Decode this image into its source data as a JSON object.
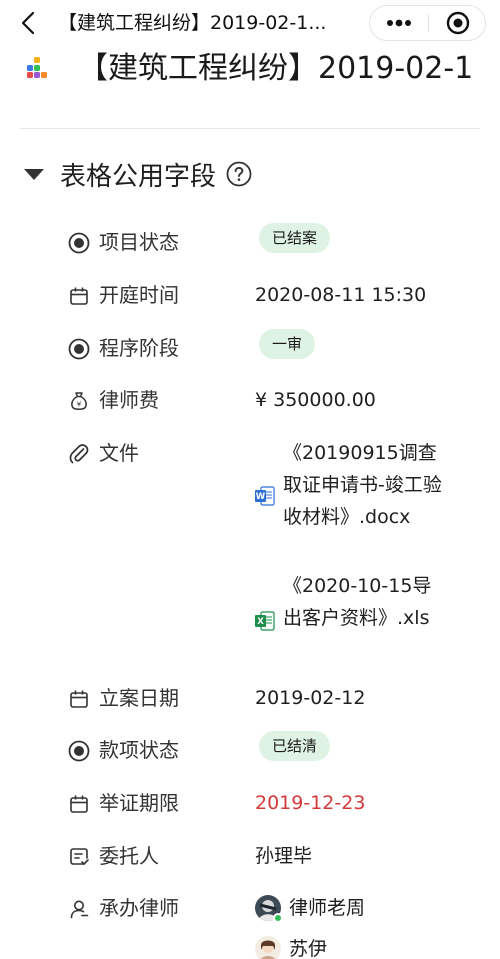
{
  "navbar": {
    "title": "【建筑工程纠纷】2019-02-1...",
    "back_icon": "chevron-left-icon",
    "more_icon": "more-dots-icon",
    "close_icon": "target-close-icon"
  },
  "record": {
    "title": "【建筑工程纠纷】2019-02-1"
  },
  "section": {
    "title": "表格公用字段",
    "help_icon": "question-circle-icon"
  },
  "fields": {
    "project_status": {
      "label": "项目状态",
      "value": "已结案",
      "icon": "radio-icon"
    },
    "court_time": {
      "label": "开庭时间",
      "value": "2020-08-11 15:30",
      "icon": "calendar-icon"
    },
    "procedure_stage": {
      "label": "程序阶段",
      "value": "一审",
      "icon": "radio-icon"
    },
    "lawyer_fee": {
      "label": "律师费",
      "value": "¥ 350000.00",
      "icon": "money-bag-icon"
    },
    "files": {
      "label": "文件",
      "icon": "paperclip-icon",
      "items": [
        {
          "name": "《20190915调查取证申请书-竣工验收材料》.docx",
          "type": "word"
        },
        {
          "name": "《2020-10-15导出客户资料》.xls",
          "type": "excel"
        }
      ]
    },
    "filing_date": {
      "label": "立案日期",
      "value": "2019-02-12",
      "icon": "calendar-icon"
    },
    "payment_status": {
      "label": "款项状态",
      "value": "已结清",
      "icon": "radio-icon"
    },
    "evidence_deadline": {
      "label": "举证期限",
      "value": "2019-12-23",
      "icon": "calendar-icon",
      "value_color": "#d23a3a"
    },
    "client": {
      "label": "委托人",
      "value": "孙理毕",
      "icon": "contact-card-icon"
    },
    "lawyers": {
      "label": "承办律师",
      "icon": "person-icon",
      "people": [
        {
          "name": "律师老周",
          "online": true
        },
        {
          "name": "苏伊",
          "online": false
        }
      ]
    }
  },
  "colors": {
    "tag_bg": "#dff3e4",
    "online": "#2fbf55",
    "word": "#2f6fd6",
    "excel": "#1f8f4c"
  }
}
